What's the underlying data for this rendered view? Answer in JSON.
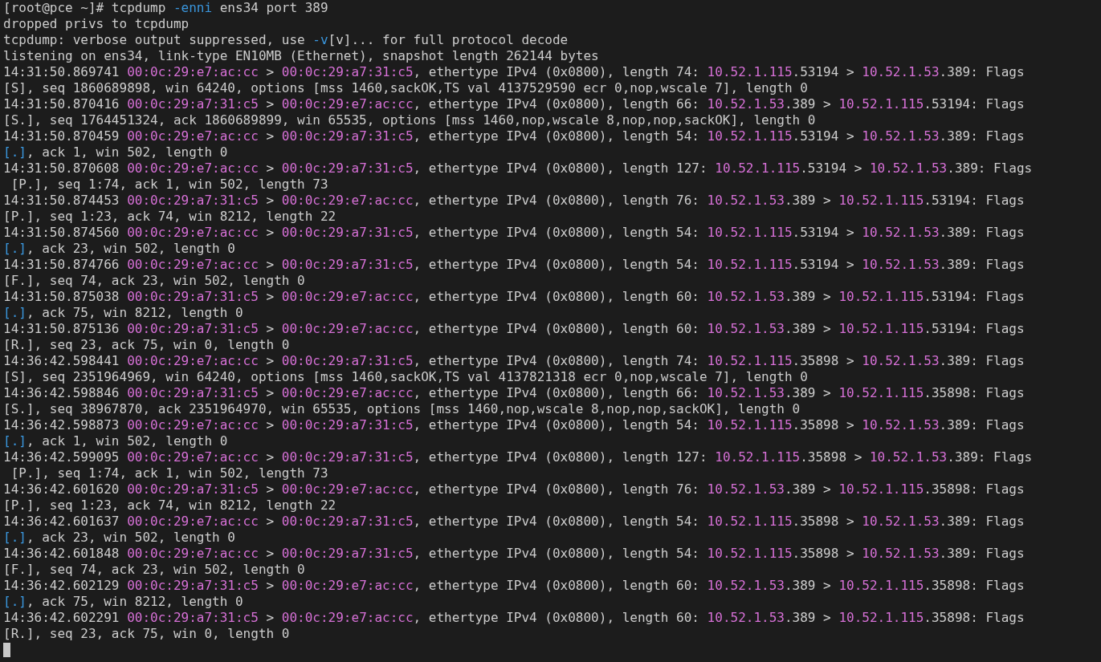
{
  "terminal": {
    "lines": [
      {
        "segments": [
          {
            "kind": "text",
            "text": "[root@pce ~]# tcpdump "
          },
          {
            "kind": "option",
            "text": "-enni"
          },
          {
            "kind": "text",
            "text": " ens34 port 389"
          }
        ]
      },
      {
        "segments": [
          {
            "kind": "text",
            "text": "dropped privs to tcpdump"
          }
        ]
      },
      {
        "segments": [
          {
            "kind": "text",
            "text": "tcpdump: verbose output suppressed, use "
          },
          {
            "kind": "option",
            "text": "-v"
          },
          {
            "kind": "text",
            "text": "[v]... for full protocol decode"
          }
        ]
      },
      {
        "segments": [
          {
            "kind": "text",
            "text": "listening on ens34, link-type EN10MB (Ethernet), snapshot length 262144 bytes"
          }
        ]
      },
      {
        "segments": [
          {
            "kind": "text",
            "text": "14:31:50.869741 "
          },
          {
            "kind": "mac",
            "text": "00:0c:29:e7:ac:cc"
          },
          {
            "kind": "text",
            "text": " > "
          },
          {
            "kind": "mac",
            "text": "00:0c:29:a7:31:c5"
          },
          {
            "kind": "text",
            "text": ", ethertype IPv4 (0x0800), length 74: "
          },
          {
            "kind": "ip",
            "text": "10.52.1.115"
          },
          {
            "kind": "text",
            "text": ".53194 > "
          },
          {
            "kind": "ip",
            "text": "10.52.1.53"
          },
          {
            "kind": "text",
            "text": ".389: Flags"
          }
        ]
      },
      {
        "segments": [
          {
            "kind": "text",
            "text": "[S], seq 1860689898, win 64240, options [mss 1460,sackOK,TS val 4137529590 ecr 0,nop,wscale 7], length 0"
          }
        ]
      },
      {
        "segments": [
          {
            "kind": "text",
            "text": "14:31:50.870416 "
          },
          {
            "kind": "mac",
            "text": "00:0c:29:a7:31:c5"
          },
          {
            "kind": "text",
            "text": " > "
          },
          {
            "kind": "mac",
            "text": "00:0c:29:e7:ac:cc"
          },
          {
            "kind": "text",
            "text": ", ethertype IPv4 (0x0800), length 66: "
          },
          {
            "kind": "ip",
            "text": "10.52.1.53"
          },
          {
            "kind": "text",
            "text": ".389 > "
          },
          {
            "kind": "ip",
            "text": "10.52.1.115"
          },
          {
            "kind": "text",
            "text": ".53194: Flags"
          }
        ]
      },
      {
        "segments": [
          {
            "kind": "text",
            "text": "[S.], seq 1764451324, ack 1860689899, win 65535, options [mss 1460,nop,wscale 8,nop,nop,sackOK], length 0"
          }
        ]
      },
      {
        "segments": [
          {
            "kind": "text",
            "text": "14:31:50.870459 "
          },
          {
            "kind": "mac",
            "text": "00:0c:29:e7:ac:cc"
          },
          {
            "kind": "text",
            "text": " > "
          },
          {
            "kind": "mac",
            "text": "00:0c:29:a7:31:c5"
          },
          {
            "kind": "text",
            "text": ", ethertype IPv4 (0x0800), length 54: "
          },
          {
            "kind": "ip",
            "text": "10.52.1.115"
          },
          {
            "kind": "text",
            "text": ".53194 > "
          },
          {
            "kind": "ip",
            "text": "10.52.1.53"
          },
          {
            "kind": "text",
            "text": ".389: Flags"
          }
        ]
      },
      {
        "segments": [
          {
            "kind": "flag",
            "text": "[.]"
          },
          {
            "kind": "text",
            "text": ", ack 1, win 502, length 0"
          }
        ]
      },
      {
        "segments": [
          {
            "kind": "text",
            "text": "14:31:50.870608 "
          },
          {
            "kind": "mac",
            "text": "00:0c:29:e7:ac:cc"
          },
          {
            "kind": "text",
            "text": " > "
          },
          {
            "kind": "mac",
            "text": "00:0c:29:a7:31:c5"
          },
          {
            "kind": "text",
            "text": ", ethertype IPv4 (0x0800), length 127: "
          },
          {
            "kind": "ip",
            "text": "10.52.1.115"
          },
          {
            "kind": "text",
            "text": ".53194 > "
          },
          {
            "kind": "ip",
            "text": "10.52.1.53"
          },
          {
            "kind": "text",
            "text": ".389: Flags"
          }
        ]
      },
      {
        "segments": [
          {
            "kind": "text",
            "text": " [P.], seq 1:74, ack 1, win 502, length 73"
          }
        ]
      },
      {
        "segments": [
          {
            "kind": "text",
            "text": "14:31:50.874453 "
          },
          {
            "kind": "mac",
            "text": "00:0c:29:a7:31:c5"
          },
          {
            "kind": "text",
            "text": " > "
          },
          {
            "kind": "mac",
            "text": "00:0c:29:e7:ac:cc"
          },
          {
            "kind": "text",
            "text": ", ethertype IPv4 (0x0800), length 76: "
          },
          {
            "kind": "ip",
            "text": "10.52.1.53"
          },
          {
            "kind": "text",
            "text": ".389 > "
          },
          {
            "kind": "ip",
            "text": "10.52.1.115"
          },
          {
            "kind": "text",
            "text": ".53194: Flags"
          }
        ]
      },
      {
        "segments": [
          {
            "kind": "text",
            "text": "[P.], seq 1:23, ack 74, win 8212, length 22"
          }
        ]
      },
      {
        "segments": [
          {
            "kind": "text",
            "text": "14:31:50.874560 "
          },
          {
            "kind": "mac",
            "text": "00:0c:29:e7:ac:cc"
          },
          {
            "kind": "text",
            "text": " > "
          },
          {
            "kind": "mac",
            "text": "00:0c:29:a7:31:c5"
          },
          {
            "kind": "text",
            "text": ", ethertype IPv4 (0x0800), length 54: "
          },
          {
            "kind": "ip",
            "text": "10.52.1.115"
          },
          {
            "kind": "text",
            "text": ".53194 > "
          },
          {
            "kind": "ip",
            "text": "10.52.1.53"
          },
          {
            "kind": "text",
            "text": ".389: Flags"
          }
        ]
      },
      {
        "segments": [
          {
            "kind": "flag",
            "text": "[.]"
          },
          {
            "kind": "text",
            "text": ", ack 23, win 502, length 0"
          }
        ]
      },
      {
        "segments": [
          {
            "kind": "text",
            "text": "14:31:50.874766 "
          },
          {
            "kind": "mac",
            "text": "00:0c:29:e7:ac:cc"
          },
          {
            "kind": "text",
            "text": " > "
          },
          {
            "kind": "mac",
            "text": "00:0c:29:a7:31:c5"
          },
          {
            "kind": "text",
            "text": ", ethertype IPv4 (0x0800), length 54: "
          },
          {
            "kind": "ip",
            "text": "10.52.1.115"
          },
          {
            "kind": "text",
            "text": ".53194 > "
          },
          {
            "kind": "ip",
            "text": "10.52.1.53"
          },
          {
            "kind": "text",
            "text": ".389: Flags"
          }
        ]
      },
      {
        "segments": [
          {
            "kind": "text",
            "text": "[F.], seq 74, ack 23, win 502, length 0"
          }
        ]
      },
      {
        "segments": [
          {
            "kind": "text",
            "text": "14:31:50.875038 "
          },
          {
            "kind": "mac",
            "text": "00:0c:29:a7:31:c5"
          },
          {
            "kind": "text",
            "text": " > "
          },
          {
            "kind": "mac",
            "text": "00:0c:29:e7:ac:cc"
          },
          {
            "kind": "text",
            "text": ", ethertype IPv4 (0x0800), length 60: "
          },
          {
            "kind": "ip",
            "text": "10.52.1.53"
          },
          {
            "kind": "text",
            "text": ".389 > "
          },
          {
            "kind": "ip",
            "text": "10.52.1.115"
          },
          {
            "kind": "text",
            "text": ".53194: Flags"
          }
        ]
      },
      {
        "segments": [
          {
            "kind": "flag",
            "text": "[.]"
          },
          {
            "kind": "text",
            "text": ", ack 75, win 8212, length 0"
          }
        ]
      },
      {
        "segments": [
          {
            "kind": "text",
            "text": "14:31:50.875136 "
          },
          {
            "kind": "mac",
            "text": "00:0c:29:a7:31:c5"
          },
          {
            "kind": "text",
            "text": " > "
          },
          {
            "kind": "mac",
            "text": "00:0c:29:e7:ac:cc"
          },
          {
            "kind": "text",
            "text": ", ethertype IPv4 (0x0800), length 60: "
          },
          {
            "kind": "ip",
            "text": "10.52.1.53"
          },
          {
            "kind": "text",
            "text": ".389 > "
          },
          {
            "kind": "ip",
            "text": "10.52.1.115"
          },
          {
            "kind": "text",
            "text": ".53194: Flags"
          }
        ]
      },
      {
        "segments": [
          {
            "kind": "text",
            "text": "[R.], seq 23, ack 75, win 0, length 0"
          }
        ]
      },
      {
        "segments": [
          {
            "kind": "text",
            "text": "14:36:42.598441 "
          },
          {
            "kind": "mac",
            "text": "00:0c:29:e7:ac:cc"
          },
          {
            "kind": "text",
            "text": " > "
          },
          {
            "kind": "mac",
            "text": "00:0c:29:a7:31:c5"
          },
          {
            "kind": "text",
            "text": ", ethertype IPv4 (0x0800), length 74: "
          },
          {
            "kind": "ip",
            "text": "10.52.1.115"
          },
          {
            "kind": "text",
            "text": ".35898 > "
          },
          {
            "kind": "ip",
            "text": "10.52.1.53"
          },
          {
            "kind": "text",
            "text": ".389: Flags"
          }
        ]
      },
      {
        "segments": [
          {
            "kind": "text",
            "text": "[S], seq 2351964969, win 64240, options [mss 1460,sackOK,TS val 4137821318 ecr 0,nop,wscale 7], length 0"
          }
        ]
      },
      {
        "segments": [
          {
            "kind": "text",
            "text": "14:36:42.598846 "
          },
          {
            "kind": "mac",
            "text": "00:0c:29:a7:31:c5"
          },
          {
            "kind": "text",
            "text": " > "
          },
          {
            "kind": "mac",
            "text": "00:0c:29:e7:ac:cc"
          },
          {
            "kind": "text",
            "text": ", ethertype IPv4 (0x0800), length 66: "
          },
          {
            "kind": "ip",
            "text": "10.52.1.53"
          },
          {
            "kind": "text",
            "text": ".389 > "
          },
          {
            "kind": "ip",
            "text": "10.52.1.115"
          },
          {
            "kind": "text",
            "text": ".35898: Flags"
          }
        ]
      },
      {
        "segments": [
          {
            "kind": "text",
            "text": "[S.], seq 38967870, ack 2351964970, win 65535, options [mss 1460,nop,wscale 8,nop,nop,sackOK], length 0"
          }
        ]
      },
      {
        "segments": [
          {
            "kind": "text",
            "text": "14:36:42.598873 "
          },
          {
            "kind": "mac",
            "text": "00:0c:29:e7:ac:cc"
          },
          {
            "kind": "text",
            "text": " > "
          },
          {
            "kind": "mac",
            "text": "00:0c:29:a7:31:c5"
          },
          {
            "kind": "text",
            "text": ", ethertype IPv4 (0x0800), length 54: "
          },
          {
            "kind": "ip",
            "text": "10.52.1.115"
          },
          {
            "kind": "text",
            "text": ".35898 > "
          },
          {
            "kind": "ip",
            "text": "10.52.1.53"
          },
          {
            "kind": "text",
            "text": ".389: Flags"
          }
        ]
      },
      {
        "segments": [
          {
            "kind": "flag",
            "text": "[.]"
          },
          {
            "kind": "text",
            "text": ", ack 1, win 502, length 0"
          }
        ]
      },
      {
        "segments": [
          {
            "kind": "text",
            "text": "14:36:42.599095 "
          },
          {
            "kind": "mac",
            "text": "00:0c:29:e7:ac:cc"
          },
          {
            "kind": "text",
            "text": " > "
          },
          {
            "kind": "mac",
            "text": "00:0c:29:a7:31:c5"
          },
          {
            "kind": "text",
            "text": ", ethertype IPv4 (0x0800), length 127: "
          },
          {
            "kind": "ip",
            "text": "10.52.1.115"
          },
          {
            "kind": "text",
            "text": ".35898 > "
          },
          {
            "kind": "ip",
            "text": "10.52.1.53"
          },
          {
            "kind": "text",
            "text": ".389: Flags"
          }
        ]
      },
      {
        "segments": [
          {
            "kind": "text",
            "text": " [P.], seq 1:74, ack 1, win 502, length 73"
          }
        ]
      },
      {
        "segments": [
          {
            "kind": "text",
            "text": "14:36:42.601620 "
          },
          {
            "kind": "mac",
            "text": "00:0c:29:a7:31:c5"
          },
          {
            "kind": "text",
            "text": " > "
          },
          {
            "kind": "mac",
            "text": "00:0c:29:e7:ac:cc"
          },
          {
            "kind": "text",
            "text": ", ethertype IPv4 (0x0800), length 76: "
          },
          {
            "kind": "ip",
            "text": "10.52.1.53"
          },
          {
            "kind": "text",
            "text": ".389 > "
          },
          {
            "kind": "ip",
            "text": "10.52.1.115"
          },
          {
            "kind": "text",
            "text": ".35898: Flags"
          }
        ]
      },
      {
        "segments": [
          {
            "kind": "text",
            "text": "[P.], seq 1:23, ack 74, win 8212, length 22"
          }
        ]
      },
      {
        "segments": [
          {
            "kind": "text",
            "text": "14:36:42.601637 "
          },
          {
            "kind": "mac",
            "text": "00:0c:29:e7:ac:cc"
          },
          {
            "kind": "text",
            "text": " > "
          },
          {
            "kind": "mac",
            "text": "00:0c:29:a7:31:c5"
          },
          {
            "kind": "text",
            "text": ", ethertype IPv4 (0x0800), length 54: "
          },
          {
            "kind": "ip",
            "text": "10.52.1.115"
          },
          {
            "kind": "text",
            "text": ".35898 > "
          },
          {
            "kind": "ip",
            "text": "10.52.1.53"
          },
          {
            "kind": "text",
            "text": ".389: Flags"
          }
        ]
      },
      {
        "segments": [
          {
            "kind": "flag",
            "text": "[.]"
          },
          {
            "kind": "text",
            "text": ", ack 23, win 502, length 0"
          }
        ]
      },
      {
        "segments": [
          {
            "kind": "text",
            "text": "14:36:42.601848 "
          },
          {
            "kind": "mac",
            "text": "00:0c:29:e7:ac:cc"
          },
          {
            "kind": "text",
            "text": " > "
          },
          {
            "kind": "mac",
            "text": "00:0c:29:a7:31:c5"
          },
          {
            "kind": "text",
            "text": ", ethertype IPv4 (0x0800), length 54: "
          },
          {
            "kind": "ip",
            "text": "10.52.1.115"
          },
          {
            "kind": "text",
            "text": ".35898 > "
          },
          {
            "kind": "ip",
            "text": "10.52.1.53"
          },
          {
            "kind": "text",
            "text": ".389: Flags"
          }
        ]
      },
      {
        "segments": [
          {
            "kind": "text",
            "text": "[F.], seq 74, ack 23, win 502, length 0"
          }
        ]
      },
      {
        "segments": [
          {
            "kind": "text",
            "text": "14:36:42.602129 "
          },
          {
            "kind": "mac",
            "text": "00:0c:29:a7:31:c5"
          },
          {
            "kind": "text",
            "text": " > "
          },
          {
            "kind": "mac",
            "text": "00:0c:29:e7:ac:cc"
          },
          {
            "kind": "text",
            "text": ", ethertype IPv4 (0x0800), length 60: "
          },
          {
            "kind": "ip",
            "text": "10.52.1.53"
          },
          {
            "kind": "text",
            "text": ".389 > "
          },
          {
            "kind": "ip",
            "text": "10.52.1.115"
          },
          {
            "kind": "text",
            "text": ".35898: Flags"
          }
        ]
      },
      {
        "segments": [
          {
            "kind": "flag",
            "text": "[.]"
          },
          {
            "kind": "text",
            "text": ", ack 75, win 8212, length 0"
          }
        ]
      },
      {
        "segments": [
          {
            "kind": "text",
            "text": "14:36:42.602291 "
          },
          {
            "kind": "mac",
            "text": "00:0c:29:a7:31:c5"
          },
          {
            "kind": "text",
            "text": " > "
          },
          {
            "kind": "mac",
            "text": "00:0c:29:e7:ac:cc"
          },
          {
            "kind": "text",
            "text": ", ethertype IPv4 (0x0800), length 60: "
          },
          {
            "kind": "ip",
            "text": "10.52.1.53"
          },
          {
            "kind": "text",
            "text": ".389 > "
          },
          {
            "kind": "ip",
            "text": "10.52.1.115"
          },
          {
            "kind": "text",
            "text": ".35898: Flags"
          }
        ]
      },
      {
        "segments": [
          {
            "kind": "text",
            "text": "[R.], seq 23, ack 75, win 0, length 0"
          }
        ]
      }
    ],
    "cursor": true
  }
}
